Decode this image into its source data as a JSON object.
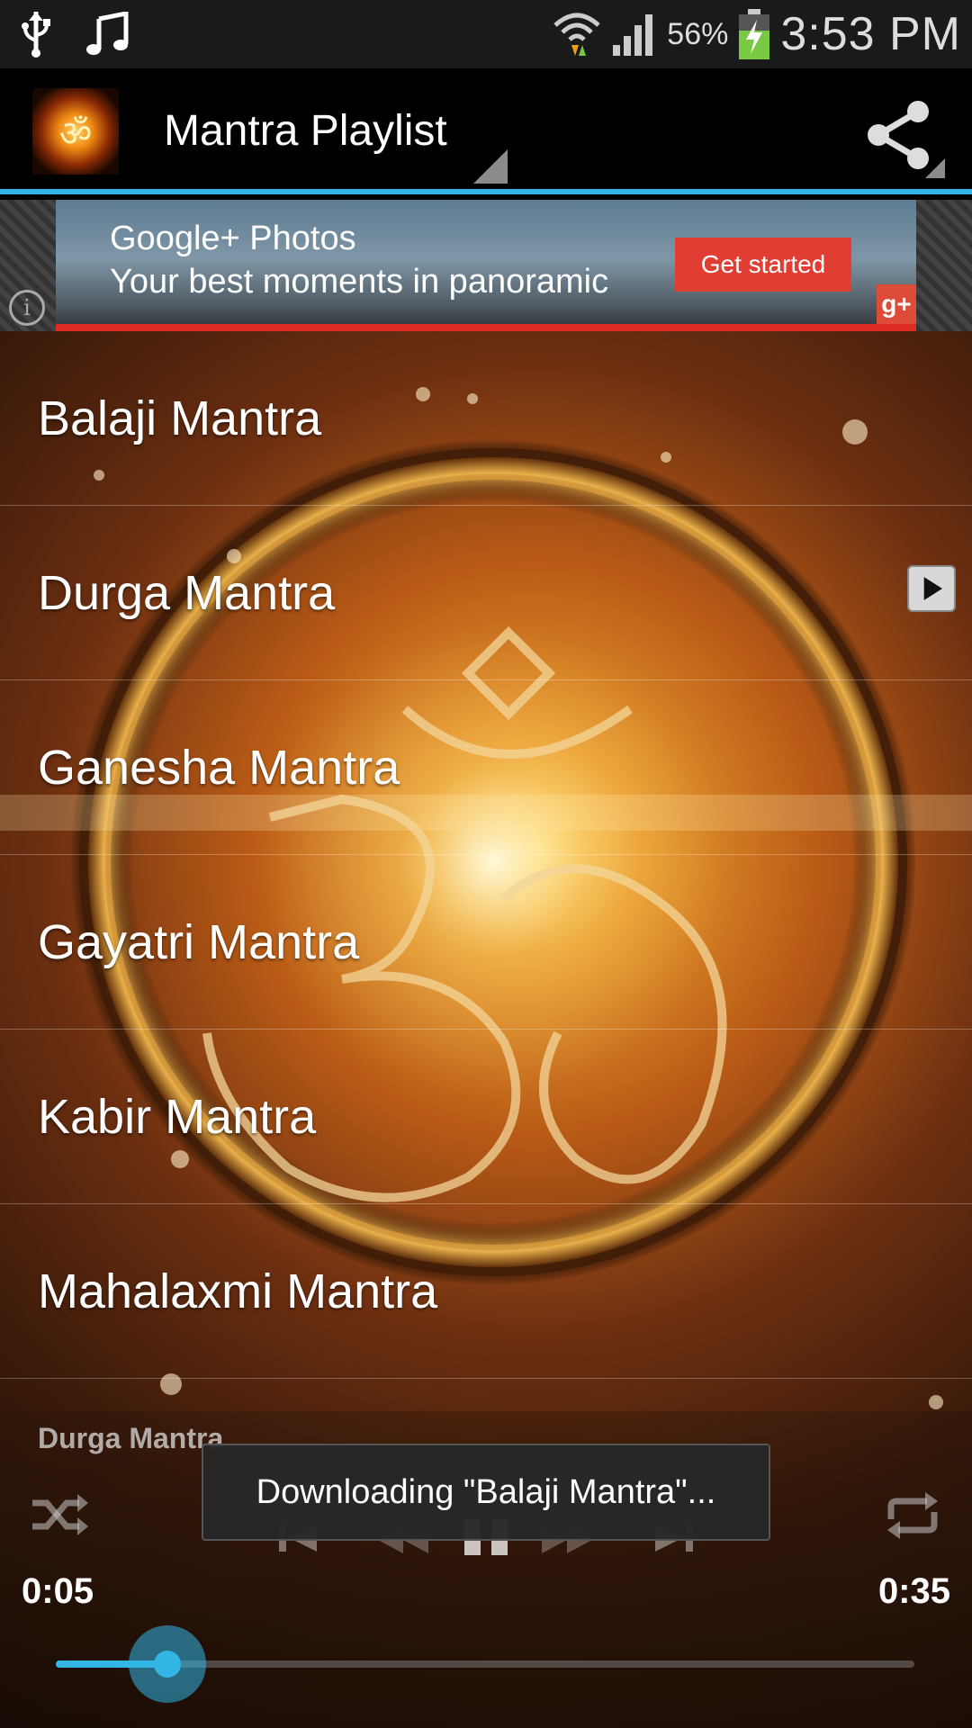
{
  "status_bar": {
    "battery_percent": "56%",
    "time": "3:53 PM",
    "icons": [
      "usb-icon",
      "music-note-icon",
      "wifi-icon",
      "signal-icon",
      "battery-charging-icon"
    ]
  },
  "action_bar": {
    "title": "Mantra Playlist",
    "app_icon": "om-app-icon",
    "share_icon": "share-icon",
    "accent_color": "#33b5e5"
  },
  "ad": {
    "line1": "Google+ Photos",
    "line2": "Your best moments in panoramic",
    "cta": "Get started",
    "badge": "g+"
  },
  "playlist": {
    "items": [
      {
        "label": "Balaji Mantra"
      },
      {
        "label": "Durga Mantra"
      },
      {
        "label": "Ganesha Mantra"
      },
      {
        "label": "Gayatri Mantra"
      },
      {
        "label": "Kabir Mantra"
      },
      {
        "label": "Mahalaxmi Mantra"
      }
    ]
  },
  "player": {
    "now_playing": "Durga Mantra",
    "elapsed": "0:05",
    "duration": "0:35",
    "progress_fraction": 0.13,
    "controls": [
      "shuffle-icon",
      "previous-icon",
      "rewind-icon",
      "pause-icon",
      "forward-icon",
      "next-icon",
      "repeat-icon"
    ]
  },
  "toast": {
    "message": "Downloading \"Balaji Mantra\"..."
  }
}
